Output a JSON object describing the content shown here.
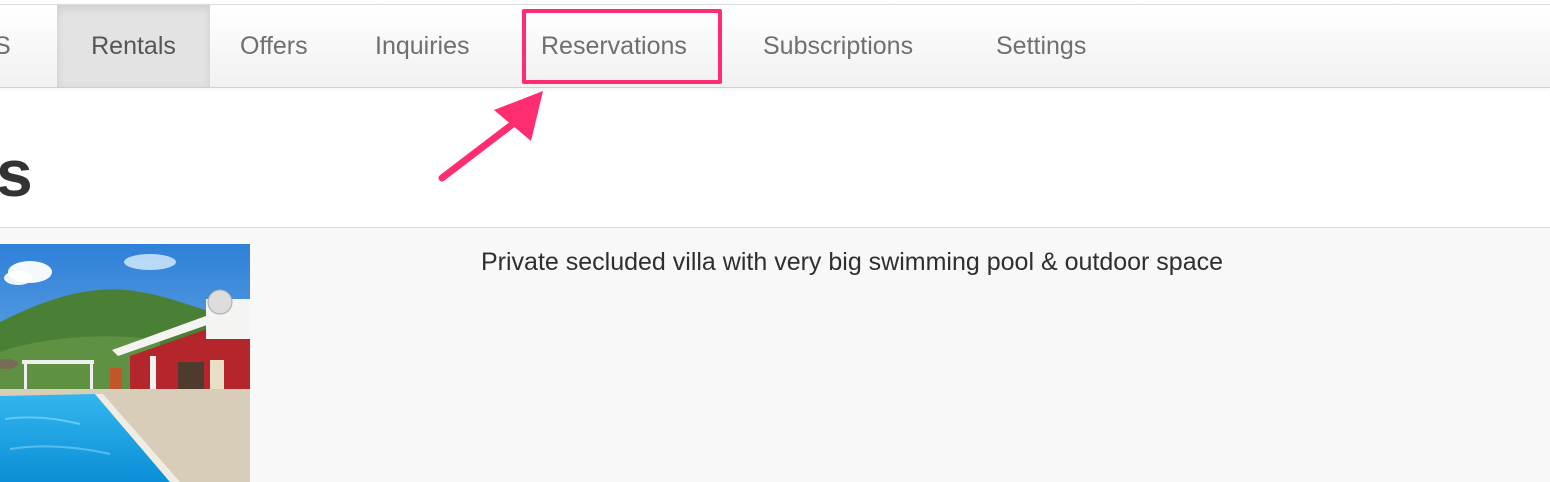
{
  "nav": {
    "items": [
      {
        "label": "S"
      },
      {
        "label": "Rentals"
      },
      {
        "label": "Offers"
      },
      {
        "label": "Inquiries"
      },
      {
        "label": "Reservations"
      },
      {
        "label": "Subscriptions"
      },
      {
        "label": "Settings"
      }
    ],
    "active": "Rentals",
    "highlighted": "Reservations"
  },
  "page": {
    "heading": "s"
  },
  "listing": {
    "title": "Private secluded villa with very big swimming pool & outdoor space",
    "photo_icon": "villa-pool-photo"
  },
  "annotation": {
    "color": "#ff2d6f"
  }
}
